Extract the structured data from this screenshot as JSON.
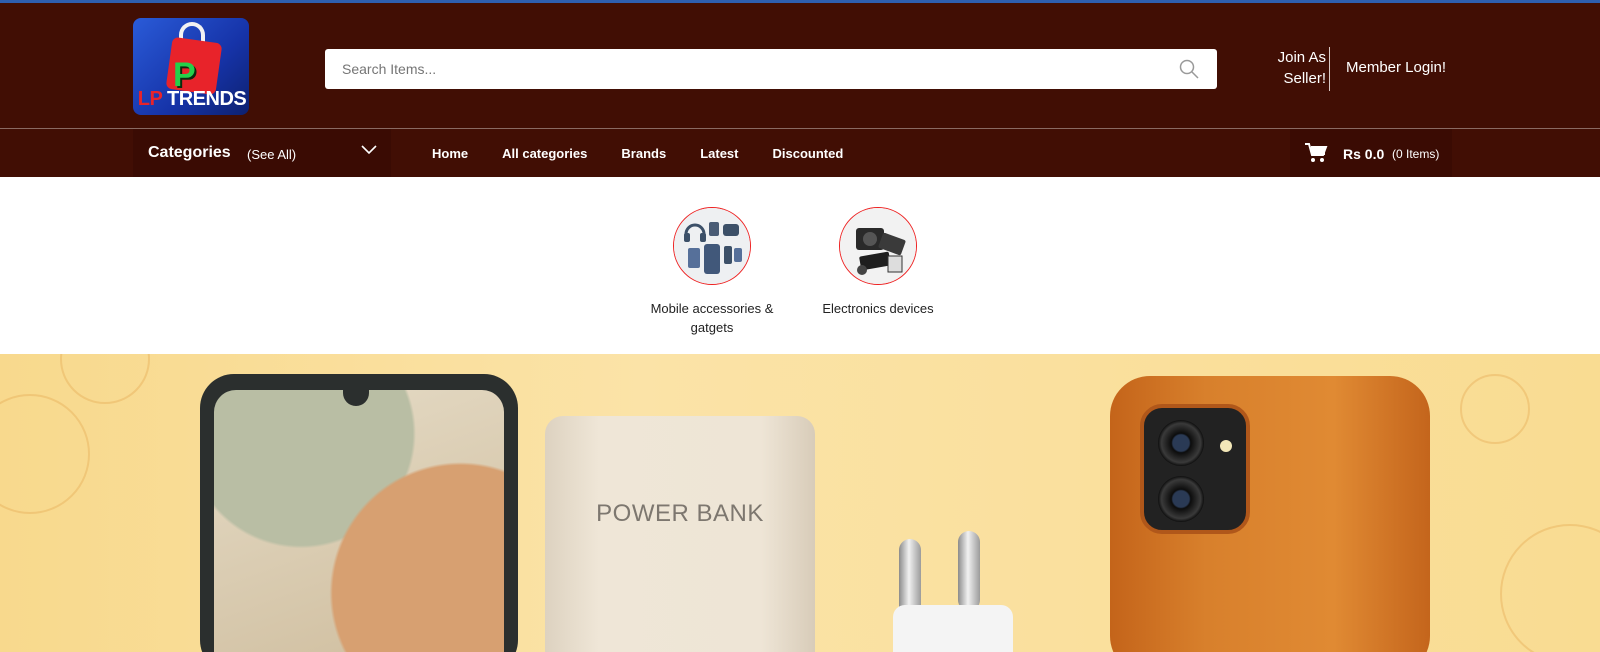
{
  "header": {
    "logo_text_lp": "LP",
    "logo_text_trends": "TRENDS",
    "logo_letter": "P",
    "search_placeholder": "Search Items...",
    "join_line1": "Join As",
    "join_line2": "Seller!",
    "member_login": "Member Login!"
  },
  "nav": {
    "categories_title": "Categories",
    "see_all": "(See All)",
    "links": [
      "Home",
      "All categories",
      "Brands",
      "Latest",
      "Discounted"
    ],
    "cart_amount": "Rs 0.0",
    "cart_items": "(0 Items)"
  },
  "categories": [
    {
      "label": "Mobile accessories & gatgets"
    },
    {
      "label": "Electronics devices"
    }
  ],
  "banner": {
    "power_bank_label": "POWER BANK"
  },
  "colors": {
    "header_bg": "#410e04",
    "top_accent": "#2e5fb0",
    "banner_bg": "#fbe3a7",
    "category_ring": "#ee2222"
  }
}
